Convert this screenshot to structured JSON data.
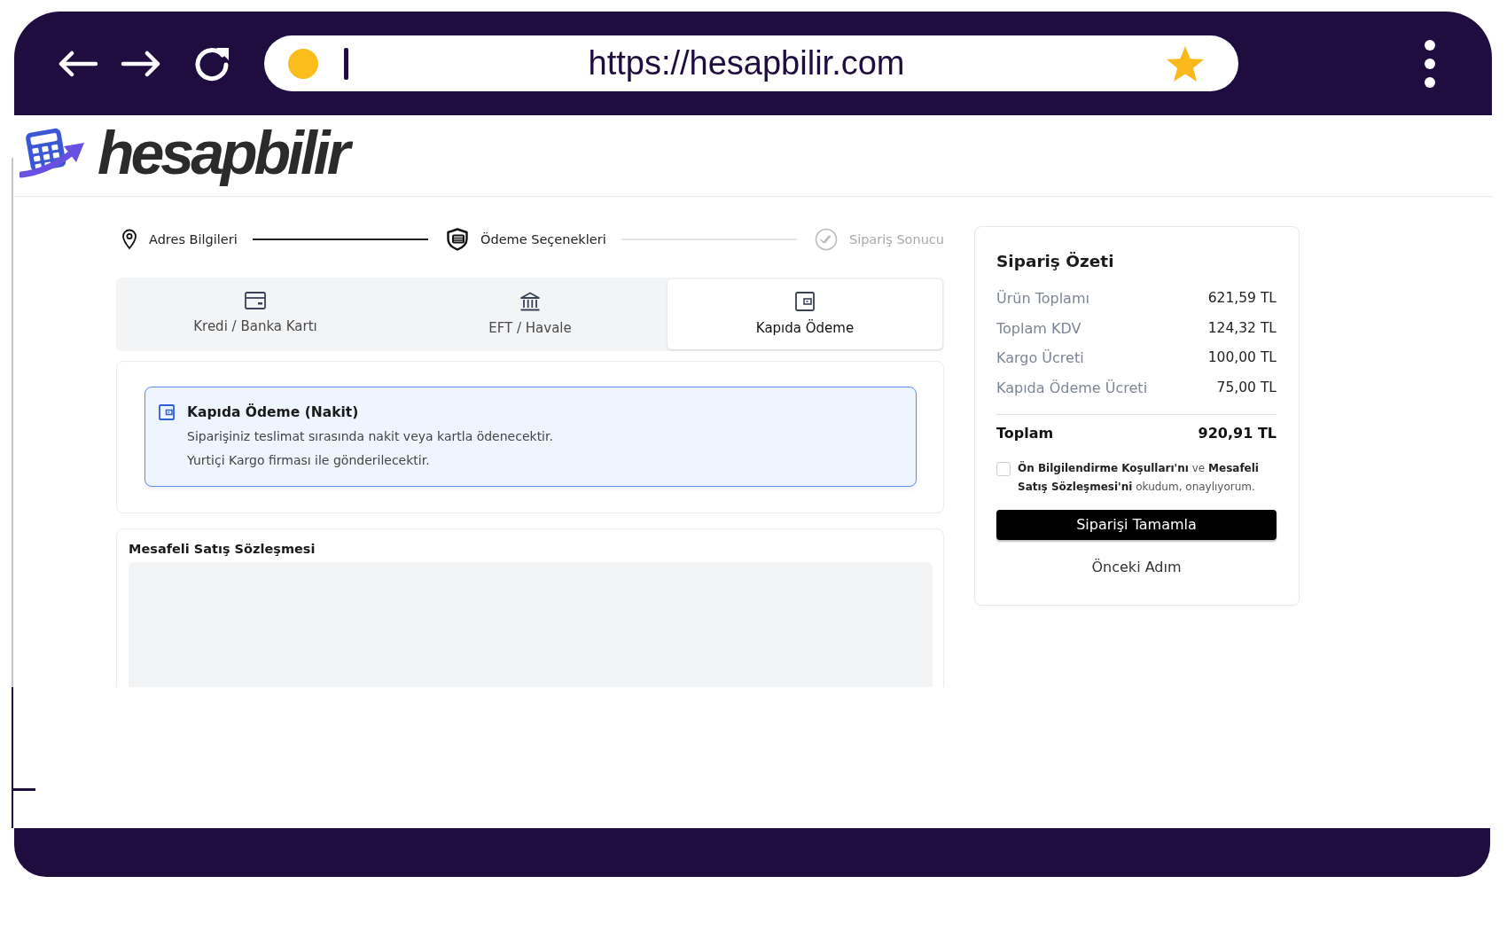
{
  "browser": {
    "url": "https://hesapbilir.com",
    "bookmarked": true
  },
  "brand": {
    "name": "hesapbilir"
  },
  "stepper": [
    {
      "label": "Adres Bilgileri",
      "kind": "address",
      "reached": true
    },
    {
      "label": "Ödeme Seçenekleri",
      "kind": "payment",
      "reached": true
    },
    {
      "label": "Sipariş Sonucu",
      "kind": "result",
      "reached": false
    }
  ],
  "payment_tabs": [
    {
      "label": "Kredi / Banka Kartı",
      "kind": "card",
      "selected": false
    },
    {
      "label": "EFT / Havale",
      "kind": "bank",
      "selected": false
    },
    {
      "label": "Kapıda Ödeme",
      "kind": "cash",
      "selected": true
    }
  ],
  "payment_info": {
    "title": "Kapıda Ödeme (Nakit)",
    "lines": [
      "Siparişiniz teslimat sırasında nakit veya kartla ödenecektir.",
      "Yurtiçi Kargo firması ile gönderilecektir."
    ]
  },
  "contract": {
    "title": "Mesafeli Satış Sözleşmesi"
  },
  "order_summary": {
    "title": "Sipariş Özeti",
    "rows": [
      {
        "label": "Ürün Toplamı",
        "value": "621,59 TL"
      },
      {
        "label": "Toplam KDV",
        "value": "124,32 TL"
      },
      {
        "label": "Kargo Ücreti",
        "value": "100,00 TL"
      },
      {
        "label": "Kapıda Ödeme Ücreti",
        "value": "75,00 TL"
      }
    ],
    "total": {
      "label": "Toplam",
      "value": "920,91 TL"
    },
    "consent": {
      "text": "**Ön Bilgilendirme Koşulları'nı** ve **Mesafeli Satış Sözleşmesi'ni** okudum, onaylıyorum.",
      "checked": false
    },
    "buttons": [
      {
        "label": "Siparişi Tamamla",
        "kind": "primary"
      },
      {
        "label": "Önceki Adım",
        "kind": "link"
      }
    ]
  }
}
